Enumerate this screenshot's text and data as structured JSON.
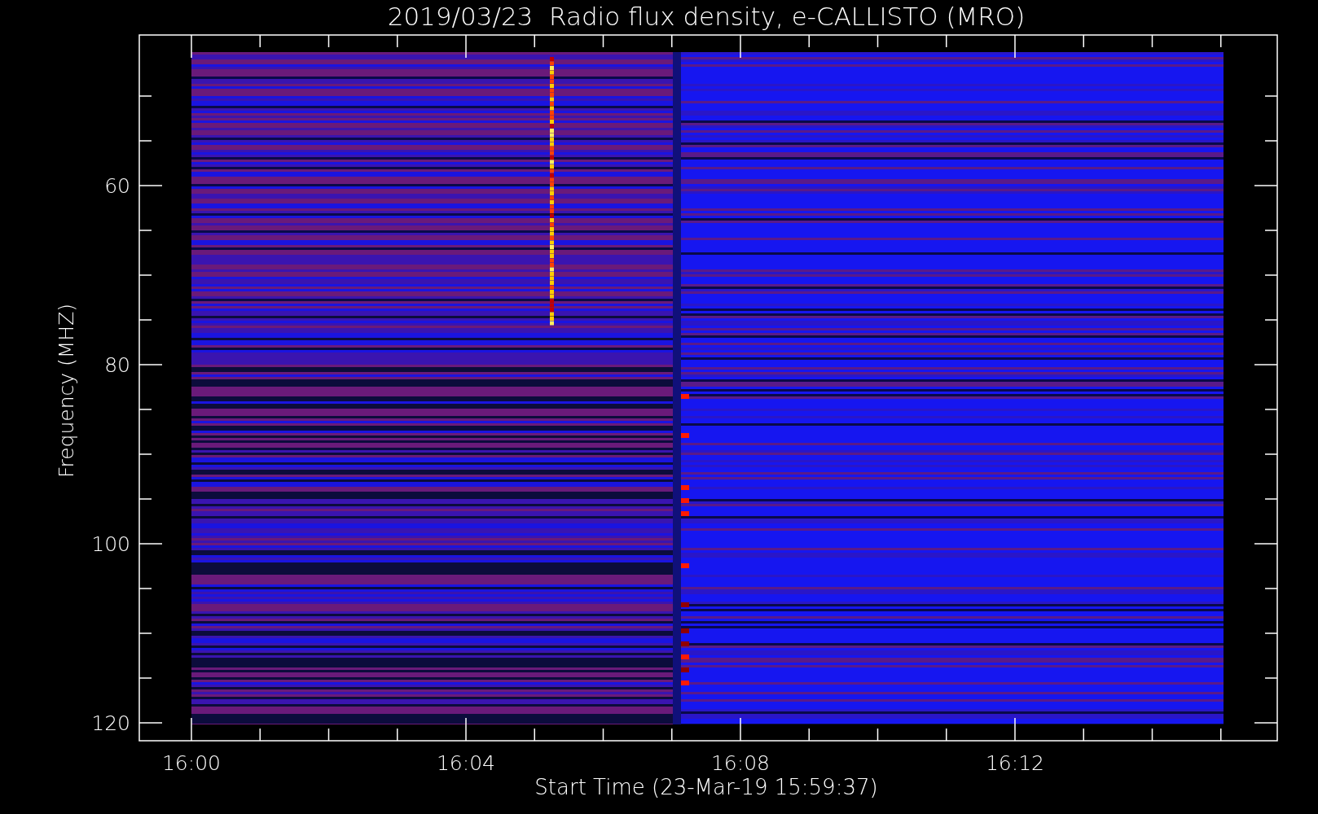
{
  "title": "2019/03/23  Radio flux density, e-CALLISTO (MRO)",
  "x_axis": {
    "label": "Start Time (23-Mar-19 15:59:37)",
    "ticks": [
      "16:00",
      "16:04",
      "16:08",
      "16:12"
    ]
  },
  "y_axis": {
    "label": "Frequency (MHZ)",
    "ticks": [
      "60",
      "80",
      "100",
      "120"
    ]
  }
}
